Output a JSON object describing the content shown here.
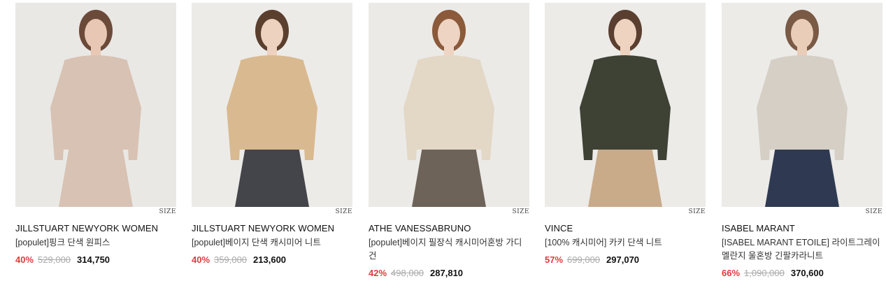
{
  "products": [
    {
      "brand": "JILLSTUART NEWYORK WOMEN",
      "name": "[populet]핑크 단색 원피스",
      "discount": "40%",
      "original_price": "529,000",
      "price": "314,750",
      "size_label": "SIZE",
      "colors": {
        "bg": "#e9e8e5",
        "garment": "#d8c2b3",
        "bottom": "#d8c2b3",
        "skin": "#e8c8b5",
        "hair": "#6b4a3a"
      }
    },
    {
      "brand": "JILLSTUART NEWYORK WOMEN",
      "name": "[populet]베이지 단색 캐시미어 니트",
      "discount": "40%",
      "original_price": "359,000",
      "price": "213,600",
      "size_label": "SIZE",
      "colors": {
        "bg": "#ecebe8",
        "garment": "#d9b98f",
        "bottom": "#44454a",
        "skin": "#edd2c0",
        "hair": "#5a3e2e"
      }
    },
    {
      "brand": "ATHE VANESSABRUNO",
      "name": "[populet]베이지 필장식 캐시미어혼방 가디건",
      "discount": "42%",
      "original_price": "498,000",
      "price": "287,810",
      "size_label": "SIZE",
      "colors": {
        "bg": "#ebeae7",
        "garment": "#e3d7c6",
        "bottom": "#6e6359",
        "skin": "#eed4c2",
        "hair": "#8a5a3a"
      }
    },
    {
      "brand": "VINCE",
      "name": "[100% 캐시미어] 카키 단색 니트",
      "discount": "57%",
      "original_price": "699,000",
      "price": "297,070",
      "size_label": "SIZE",
      "colors": {
        "bg": "#ecebe8",
        "garment": "#3e4234",
        "bottom": "#c9ab8a",
        "skin": "#eed3c1",
        "hair": "#5a3f30"
      }
    },
    {
      "brand": "ISABEL MARANT",
      "name": "[ISABEL MARANT ETOILE] 라이트그레이 멜란지 울혼방 긴팔카라니트",
      "discount": "66%",
      "original_price": "1,090,000",
      "price": "370,600",
      "size_label": "SIZE",
      "colors": {
        "bg": "#ecebe8",
        "garment": "#d5cfc5",
        "bottom": "#2f3a52",
        "skin": "#e9cdb9",
        "hair": "#7a5a45"
      }
    }
  ]
}
